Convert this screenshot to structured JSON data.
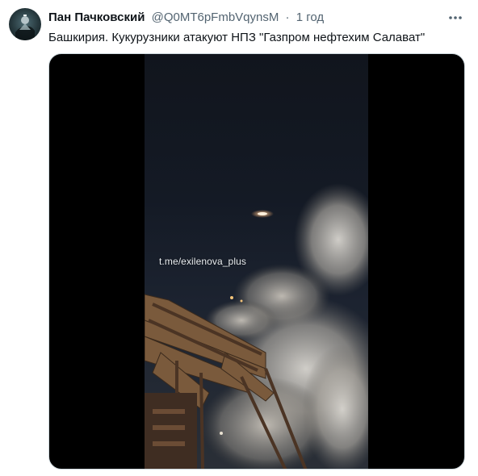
{
  "tweet": {
    "display_name": "Пан Пачковский",
    "handle": "@Q0MT6pFmbVqynsM",
    "separator": "·",
    "time_ago": "1 год",
    "text": "Башкирия. Кукурузники атакуют НПЗ \"Газпром нефтехим Салават\"",
    "more_icon": "more-dots-icon"
  },
  "media": {
    "watermark": "t.me/exilenova_plus",
    "background_color": "#000000"
  },
  "colors": {
    "name": "#0f1419",
    "secondary": "#536471",
    "border": "#cfd9de"
  }
}
